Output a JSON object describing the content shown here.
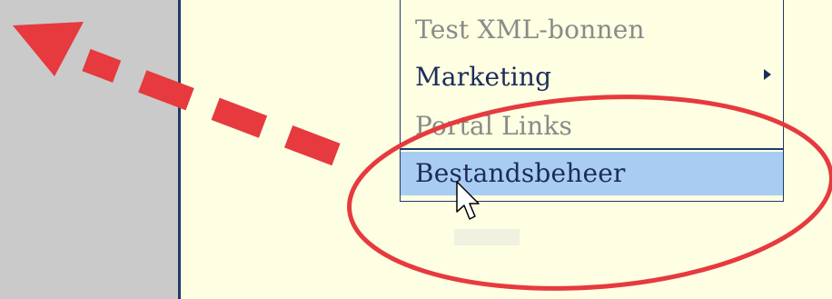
{
  "menu": {
    "items": [
      {
        "label": "Test XML-bonnen",
        "state": "disabled"
      },
      {
        "label": "Marketing",
        "state": "enabled",
        "has_submenu": true
      },
      {
        "label": "Portal Links",
        "state": "disabled"
      },
      {
        "label": "Bestandsbeheer",
        "state": "highlighted"
      }
    ]
  },
  "colors": {
    "background": "#fefee2",
    "sidebar": "#cacaca",
    "border": "#1f3a6b",
    "highlight": "#a9cdf2",
    "annotation": "#e63a3e",
    "disabled_text": "#8a8a8a",
    "text": "#1c2c5c"
  },
  "icons": {
    "submenu": "chevron-right-icon",
    "cursor": "mouse-pointer-icon",
    "annotation_arrow": "dashed-arrow-icon"
  }
}
